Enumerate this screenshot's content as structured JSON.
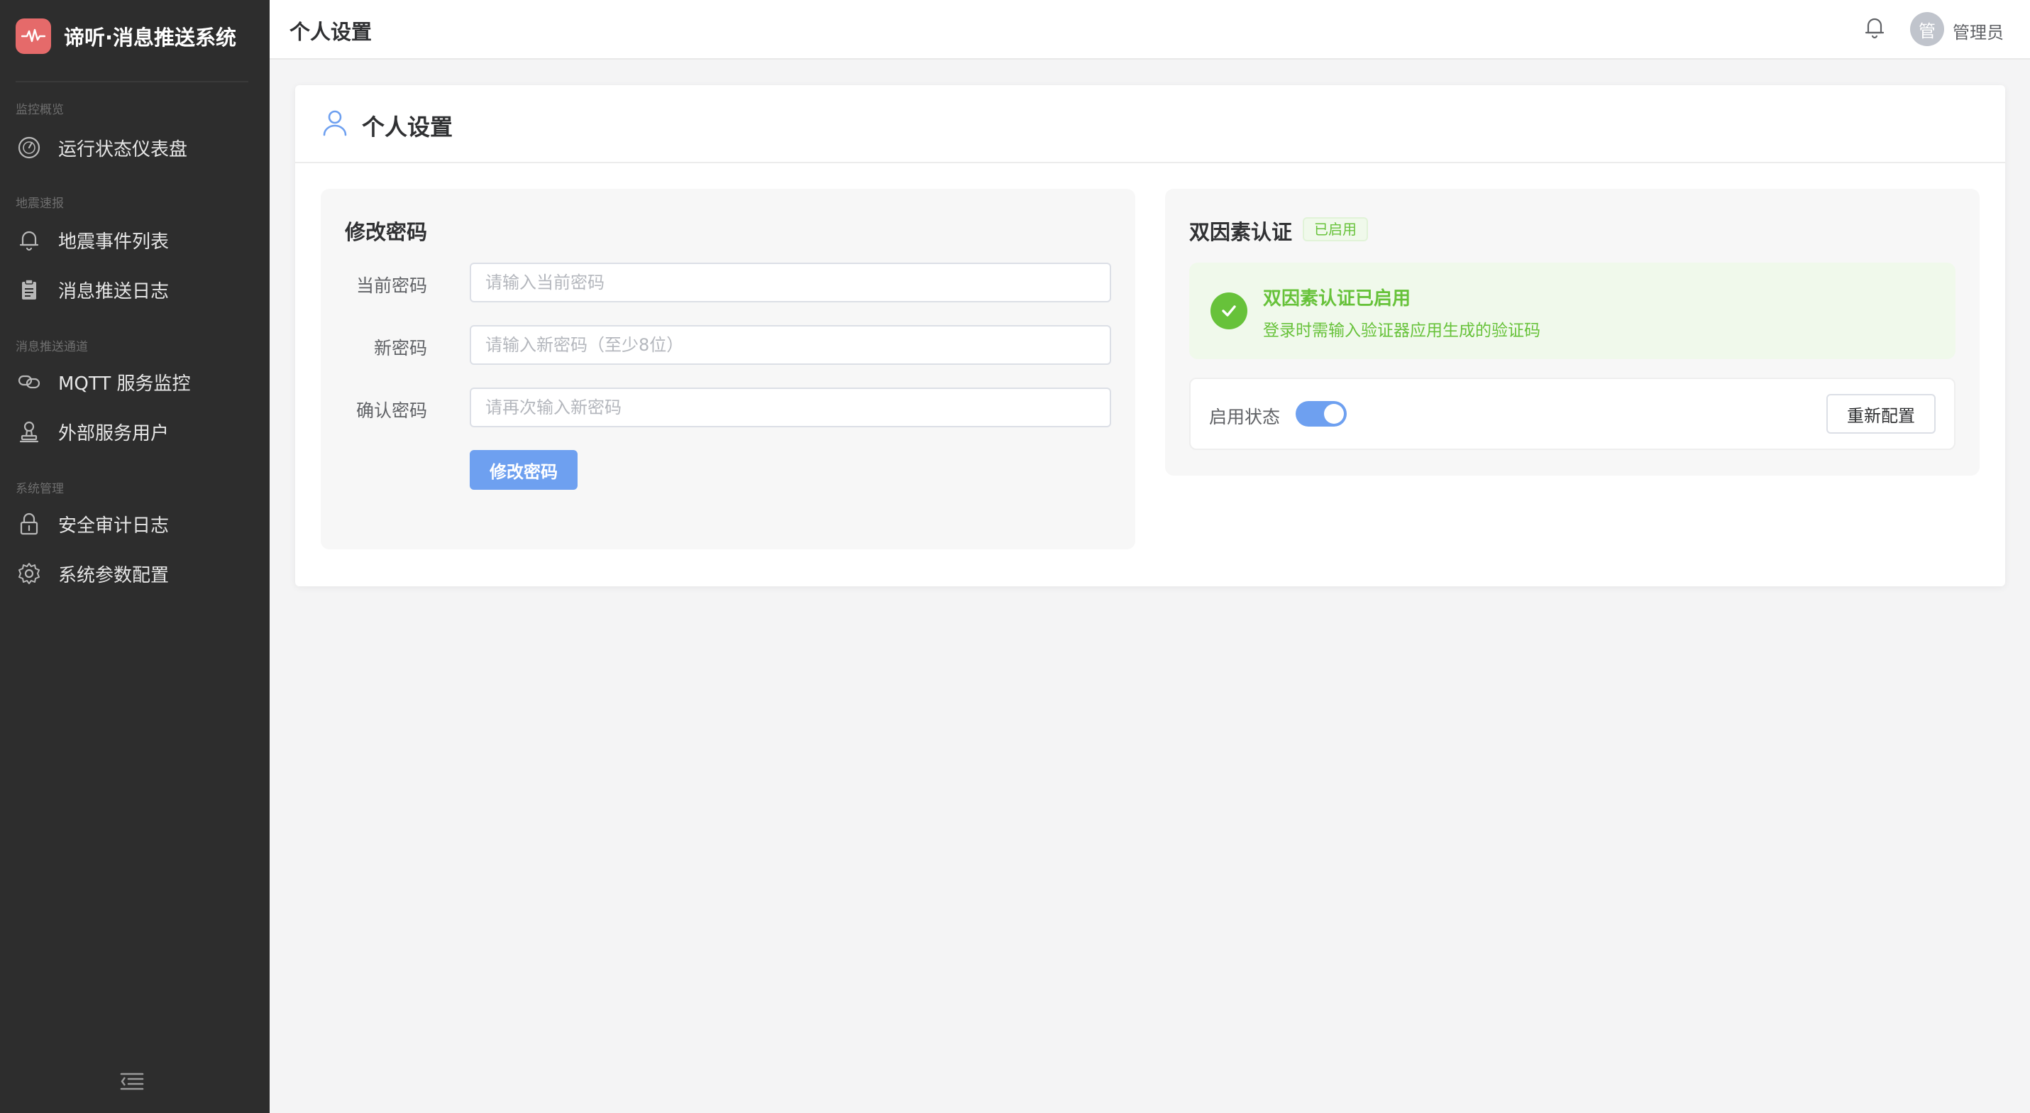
{
  "app": {
    "title": "谛听·消息推送系统",
    "logo_icon": "waveform-icon",
    "brand_color": "#e56a6a"
  },
  "sidebar": {
    "sections": [
      {
        "label": "监控概览",
        "items": [
          {
            "label": "运行状态仪表盘",
            "icon": "gauge-icon"
          }
        ]
      },
      {
        "label": "地震速报",
        "items": [
          {
            "label": "地震事件列表",
            "icon": "bell-icon"
          },
          {
            "label": "消息推送日志",
            "icon": "clipboard-icon"
          }
        ]
      },
      {
        "label": "消息推送通道",
        "items": [
          {
            "label": "MQTT 服务监控",
            "icon": "link-icon"
          },
          {
            "label": "外部服务用户",
            "icon": "user-stamp-icon"
          }
        ]
      },
      {
        "label": "系统管理",
        "items": [
          {
            "label": "安全审计日志",
            "icon": "lock-icon"
          },
          {
            "label": "系统参数配置",
            "icon": "gear-icon"
          }
        ]
      }
    ],
    "collapse_icon": "menu-collapse-icon"
  },
  "header": {
    "title": "个人设置",
    "avatar_text": "管",
    "user_name": "管理员"
  },
  "page": {
    "title": "个人设置",
    "password": {
      "title": "修改密码",
      "current_label": "当前密码",
      "current_placeholder": "请输入当前密码",
      "new_label": "新密码",
      "new_placeholder": "请输入新密码（至少8位）",
      "confirm_label": "确认密码",
      "confirm_placeholder": "请再次输入新密码",
      "submit_label": "修改密码"
    },
    "two_factor": {
      "title": "双因素认证",
      "tag": "已启用",
      "alert_title": "双因素认证已启用",
      "alert_desc": "登录时需输入验证器应用生成的验证码",
      "status_label": "启用状态",
      "enabled": true,
      "reconfigure_label": "重新配置"
    }
  },
  "colors": {
    "primary": "#6ea0f0",
    "success": "#67c23a",
    "sidebar_bg": "#2d2d2d"
  }
}
